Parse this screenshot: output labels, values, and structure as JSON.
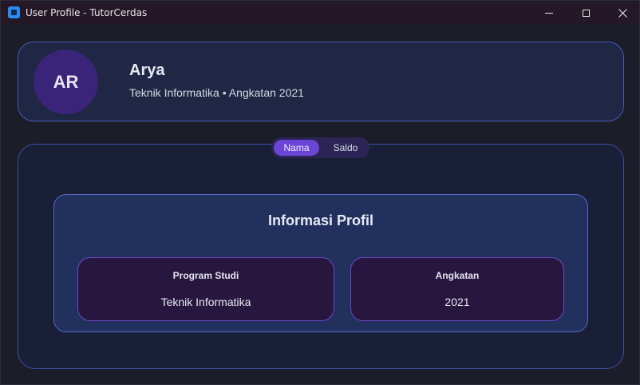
{
  "window": {
    "title": "User Profile - TutorCerdas"
  },
  "profile": {
    "initials": "AR",
    "name": "Arya",
    "subtitle": "Teknik Informatika • Angkatan 2021"
  },
  "tabs": {
    "items": [
      {
        "label": "Nama",
        "active": true
      },
      {
        "label": "Saldo",
        "active": false
      }
    ]
  },
  "info": {
    "title": "Informasi Profil",
    "fields": [
      {
        "label": "Program Studi",
        "value": "Teknik Informatika"
      },
      {
        "label": "Angkatan",
        "value": "2021"
      }
    ]
  },
  "icons": {
    "app": "app-icon",
    "minimize": "minimize-icon",
    "maximize": "maximize-icon",
    "close": "close-icon"
  },
  "colors": {
    "accent": "#6b46d6",
    "card_border": "#4a5ab8",
    "background": "#1b1d29"
  }
}
